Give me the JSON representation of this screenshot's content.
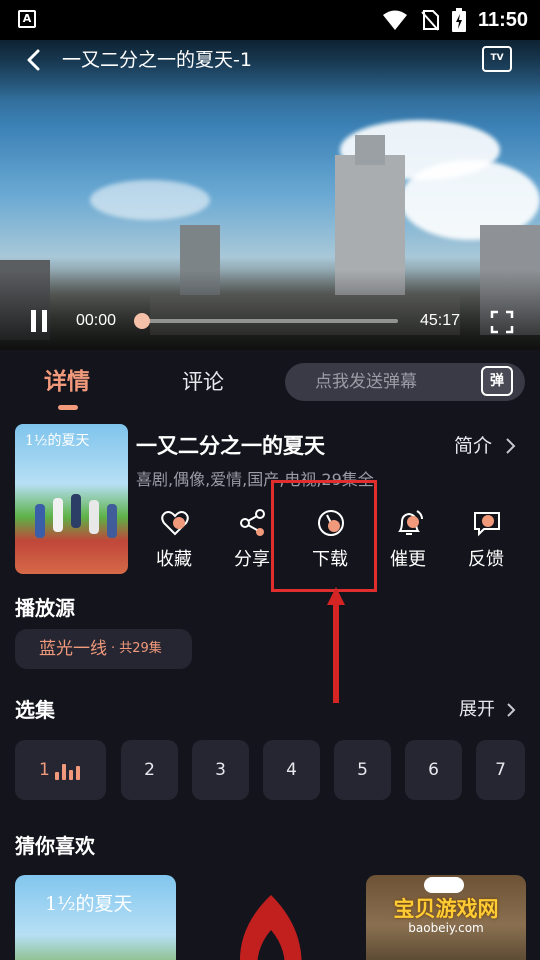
{
  "status_bar": {
    "time": "11:50",
    "notification_icon_letter": "A"
  },
  "player": {
    "title": "一又二分之一的夏天-1",
    "tv_label": "TV",
    "current_time": "00:00",
    "duration": "45:17",
    "progress_fraction": 0.0
  },
  "tabs": [
    {
      "label": "详情",
      "active": true
    },
    {
      "label": "评论",
      "active": false
    }
  ],
  "danmaku": {
    "placeholder": "点我发送弹幕",
    "icon_label": "弹"
  },
  "show": {
    "title": "一又二分之一的夏天",
    "intro_label": "简介",
    "tags": "喜剧,偶像,爱情,国产,电视,29集全",
    "poster_title": "1½的夏天"
  },
  "actions": [
    {
      "label": "收藏",
      "icon": "heart-icon"
    },
    {
      "label": "分享",
      "icon": "share-icon"
    },
    {
      "label": "下载",
      "icon": "download-icon"
    },
    {
      "label": "催更",
      "icon": "bell-icon"
    },
    {
      "label": "反馈",
      "icon": "feedback-icon"
    }
  ],
  "source_section": {
    "title": "播放源",
    "source_name": "蓝光一线",
    "source_count": "· 共29集"
  },
  "episodes_section": {
    "title": "选集",
    "expand_label": "展开",
    "episodes": [
      "1",
      "2",
      "3",
      "4",
      "5",
      "6",
      "7"
    ]
  },
  "recommend_section": {
    "title": "猜你喜欢",
    "first_title": "1½的夏天",
    "watermark": "宝贝游戏网",
    "watermark_url": "baobeiy.com"
  },
  "colors": {
    "accent": "#f0997b",
    "background": "#14141c",
    "chip": "#262632",
    "highlight": "#e02d2d"
  }
}
